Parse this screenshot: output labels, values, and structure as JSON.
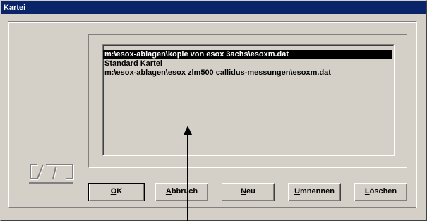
{
  "window": {
    "title": "Kartei"
  },
  "list": {
    "items": [
      {
        "label": "m:\\esox-ablagen\\kopie von esox  3achs\\esoxm.dat",
        "selected": true
      },
      {
        "label": "Standard Kartei",
        "selected": false
      },
      {
        "label": "m:\\esox-ablagen\\esox zlm500 callidus-messungen\\esoxm.dat",
        "selected": false
      }
    ]
  },
  "buttons": {
    "ok": {
      "mnemonic": "O",
      "rest": "K"
    },
    "abbruch": {
      "mnemonic": "A",
      "rest": "bbruch"
    },
    "neu": {
      "mnemonic": "N",
      "rest": "eu"
    },
    "umnennen": {
      "mnemonic": "U",
      "rest": "mnennen"
    },
    "loeschen": {
      "mnemonic": "L",
      "rest": "öschen"
    }
  },
  "colors": {
    "titlebar": "#0a246a",
    "face": "#d4d0c8",
    "selection": "#000000"
  },
  "icons": {
    "logo": "kartei-logo-icon",
    "cursor": "arrow-cursor-icon"
  }
}
